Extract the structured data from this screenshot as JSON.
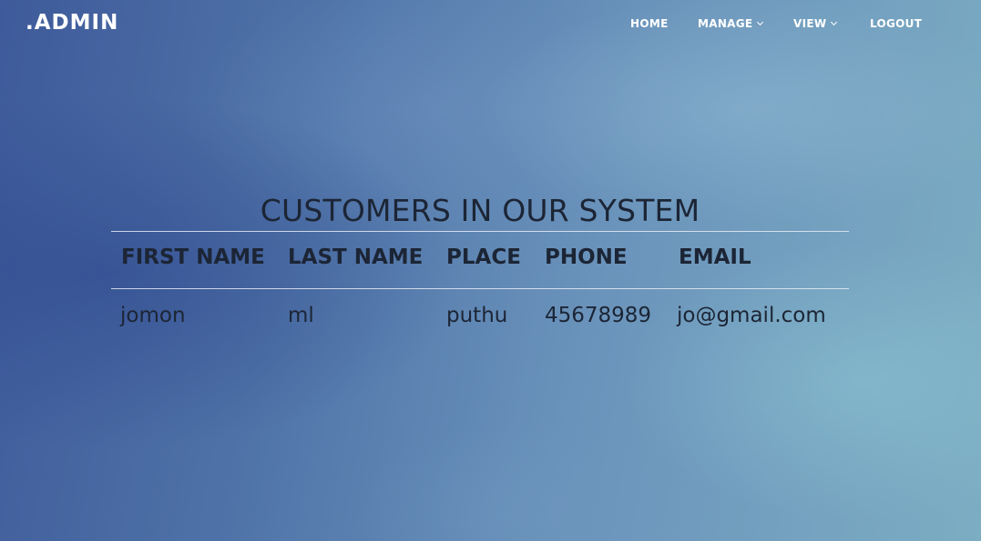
{
  "brand": ".ADMIN",
  "nav": {
    "home": "HOME",
    "manage": "MANAGE",
    "view": "VIEW",
    "logout": "LOGOUT"
  },
  "page_title": "CUSTOMERS IN OUR SYSTEM",
  "table": {
    "headers": [
      "FIRST NAME",
      "LAST NAME",
      "PLACE",
      "PHONE",
      "EMAIL"
    ],
    "rows": [
      [
        "jomon",
        "ml",
        "puthu",
        "45678989",
        "jo@gmail.com"
      ]
    ]
  },
  "colors": {
    "text_dark": "#1c2535",
    "nav_text": "#ffffff",
    "background_left": "#3e5a9a",
    "background_right": "#7cadc3"
  },
  "icons": [
    "chevron-down-icon"
  ]
}
